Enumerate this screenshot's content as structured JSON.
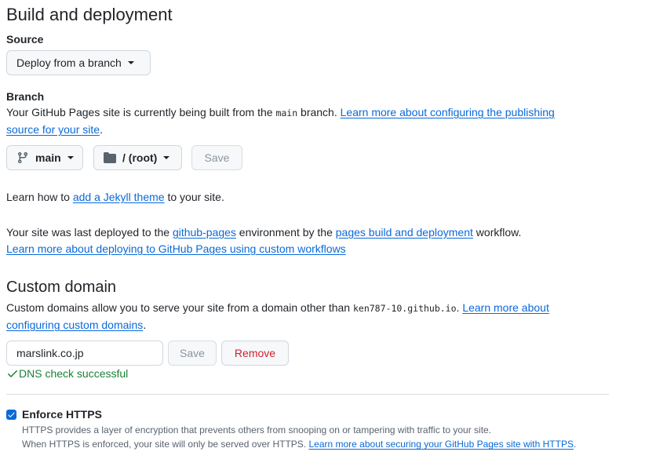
{
  "build": {
    "title": "Build and deployment",
    "source_label": "Source",
    "source_value": "Deploy from a branch",
    "branch_label": "Branch",
    "branch_text_before": "Your GitHub Pages site is currently being built from the ",
    "branch_code": "main",
    "branch_text_after": " branch. ",
    "branch_link_line1": "Learn more about configuring the publishing",
    "branch_link_line2": "source for your site",
    "branch_period": ".",
    "branch_select": "main",
    "folder_select": "/ (root)",
    "save_label": "Save",
    "jekyll_before": "Learn how to ",
    "jekyll_link": "add a Jekyll theme",
    "jekyll_after": " to your site.",
    "deployed_before": "Your site was last deployed to the ",
    "deployed_env_link": "github-pages",
    "deployed_middle": " environment by the ",
    "deployed_workflow_link": "pages build and deployment",
    "deployed_after": " workflow.",
    "workflows_link": "Learn more about deploying to GitHub Pages using custom workflows"
  },
  "custom_domain": {
    "title": "Custom domain",
    "desc_before": "Custom domains allow you to serve your site from a domain other than ",
    "desc_code": "ken787-10.github.io",
    "desc_after": ". ",
    "learn_link_line1": "Learn more about",
    "learn_link_line2": "configuring custom domains",
    "period": ".",
    "domain_value": "marslink.co.jp",
    "save_label": "Save",
    "remove_label": "Remove",
    "dns_status": "DNS check successful"
  },
  "https": {
    "label": "Enforce HTTPS",
    "checked": true,
    "desc_line1": "HTTPS provides a layer of encryption that prevents others from snooping on or tampering with traffic to your site.",
    "desc_line2_before": "When HTTPS is enforced, your site will only be served over HTTPS. ",
    "desc_line2_link": "Learn more about securing your GitHub Pages site with HTTPS",
    "desc_line2_after": "."
  },
  "colors": {
    "link": "#0969da",
    "success": "#1a7f37",
    "danger": "#cf222e",
    "checkbox": "#0969da"
  },
  "icons": {
    "branch": "git-branch-icon",
    "folder": "folder-icon",
    "caret": "triangle-down-icon",
    "check": "check-icon"
  }
}
